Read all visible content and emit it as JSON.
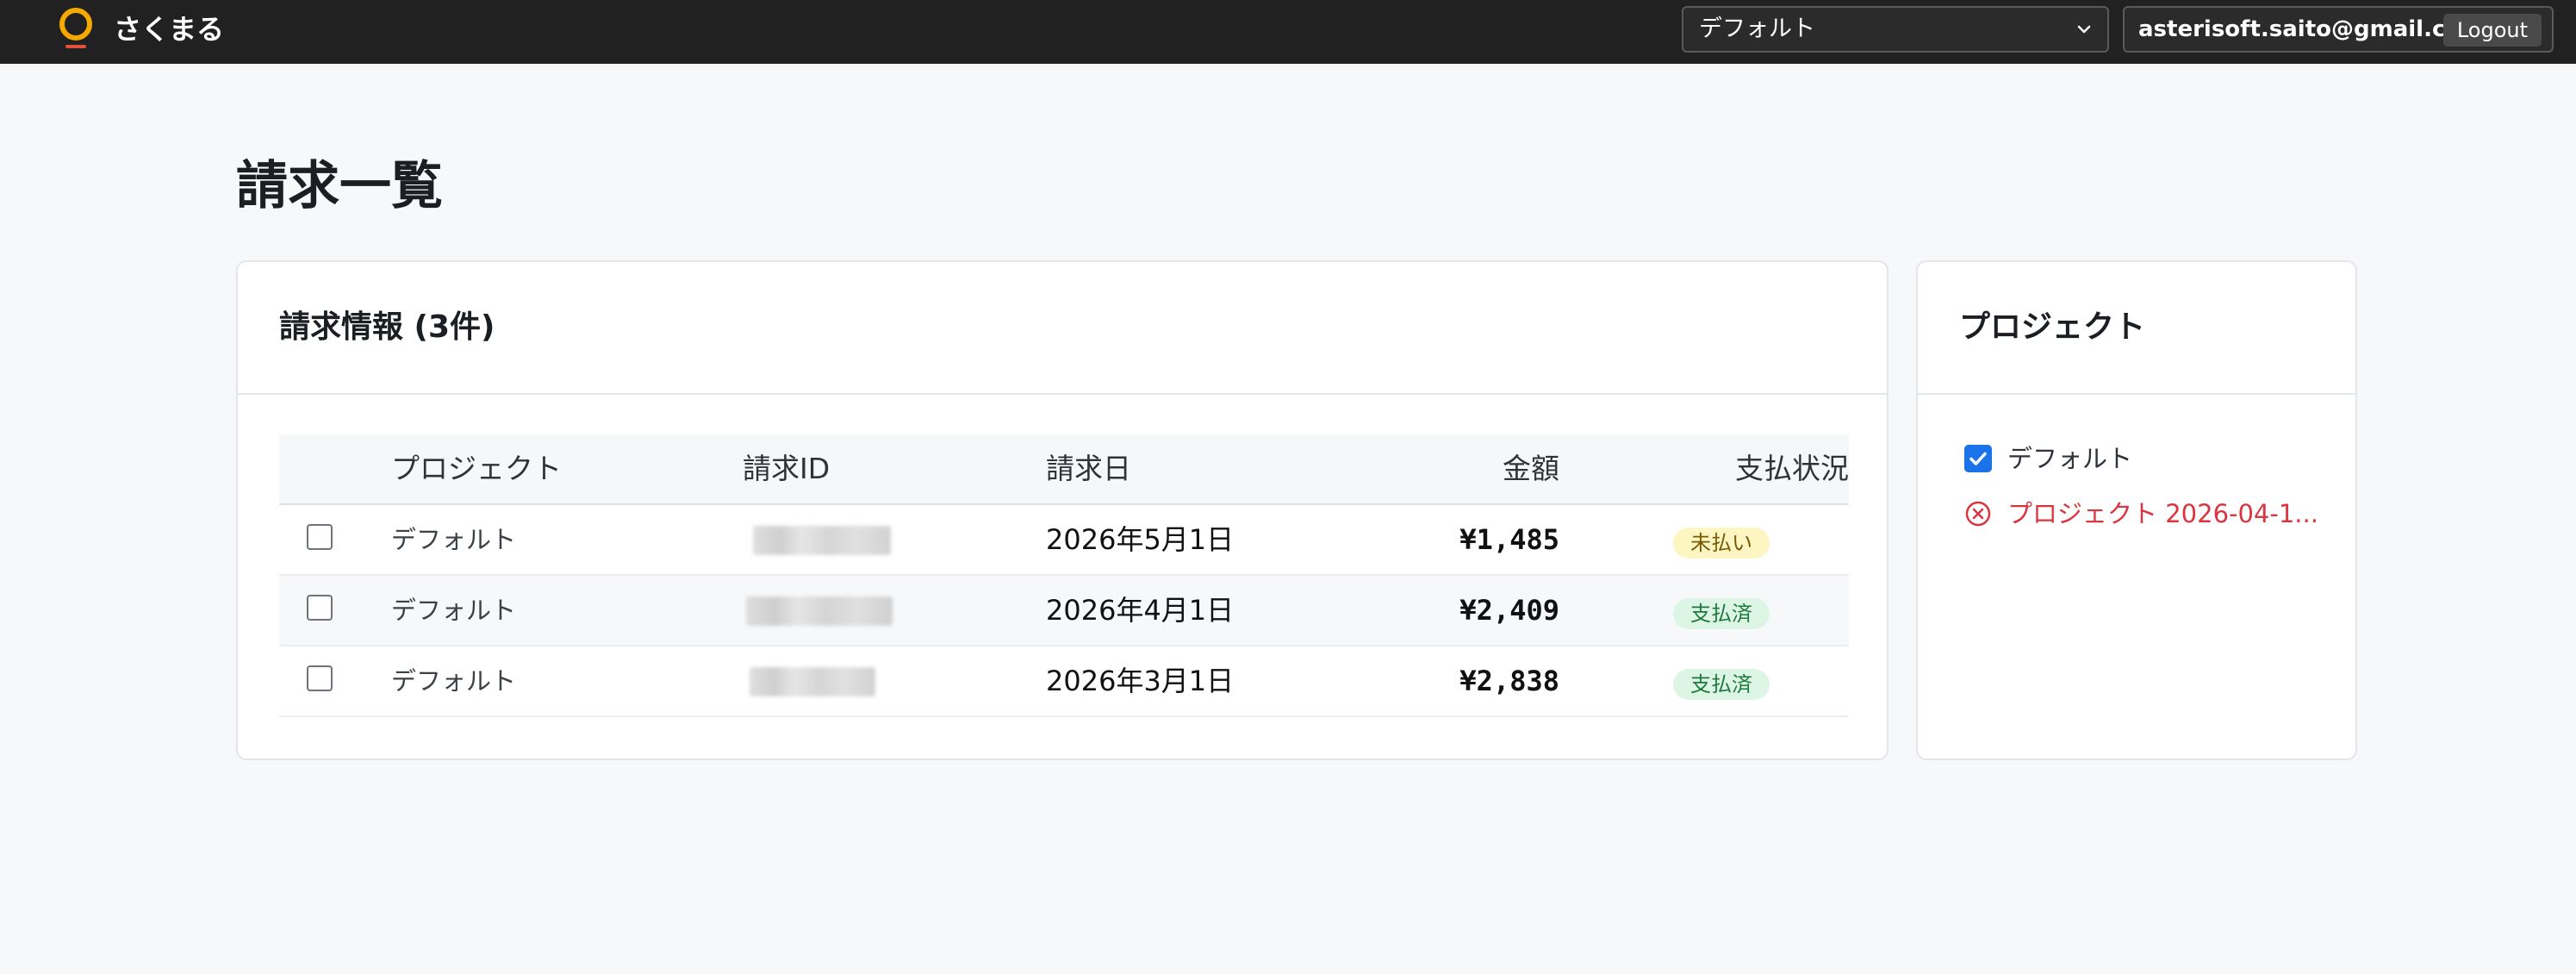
{
  "app": {
    "name": "さくまる"
  },
  "navbar": {
    "project_selector": {
      "value": "デフォルト"
    },
    "user": {
      "email": "asterisoft.saito@gmail.com",
      "logout_label": "Logout"
    }
  },
  "page": {
    "title": "請求一覧"
  },
  "billing": {
    "card_title": "請求情報 (3件)",
    "columns": [
      "プロジェクト",
      "請求ID",
      "請求日",
      "金額",
      "支払状況"
    ],
    "rows": [
      {
        "project": "デフォルト",
        "date": "2026年5月1日",
        "amount": "¥1,485",
        "status": "未払い",
        "status_type": "unpaid"
      },
      {
        "project": "デフォルト",
        "date": "2026年4月1日",
        "amount": "¥2,409",
        "status": "支払済",
        "status_type": "paid"
      },
      {
        "project": "デフォルト",
        "date": "2026年3月1日",
        "amount": "¥2,838",
        "status": "支払済",
        "status_type": "paid"
      }
    ]
  },
  "projects_panel": {
    "title": "プロジェクト",
    "items": [
      {
        "label": "デフォルト",
        "state": "checked"
      },
      {
        "label": "プロジェクト 2026-04-1...",
        "state": "error"
      }
    ]
  },
  "colors": {
    "navbar": "#212121",
    "background": "#f7f8fa",
    "accent": "#1a73e8",
    "error": "#d93640",
    "logo": "#f5a800",
    "unpaid_badge": "#fdf6c3",
    "paid_badge": "#dcf5e4"
  }
}
